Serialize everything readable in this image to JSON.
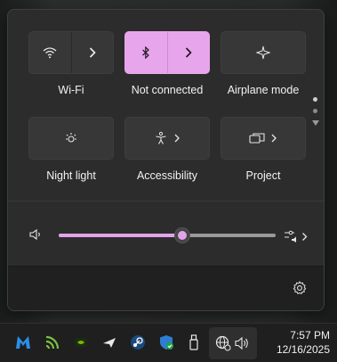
{
  "quick_settings": {
    "tiles": [
      {
        "label": "Wi-Fi",
        "icon": "wifi-icon",
        "state": "off",
        "has_expand": true
      },
      {
        "label": "Not connected",
        "icon": "bluetooth-icon",
        "state": "on",
        "has_expand": true
      },
      {
        "label": "Airplane mode",
        "icon": "airplane-icon",
        "state": "off",
        "has_expand": false
      },
      {
        "label": "Night light",
        "icon": "night-light-icon",
        "state": "off",
        "has_expand": false
      },
      {
        "label": "Accessibility",
        "icon": "accessibility-icon",
        "state": "off",
        "has_expand": true
      },
      {
        "label": "Project",
        "icon": "project-icon",
        "state": "off",
        "has_expand": true
      }
    ],
    "pages": {
      "count": 2,
      "current": 1
    },
    "volume": {
      "level_fraction": 0.57,
      "icon": "speaker-icon",
      "audio_output_icon": "audio-output-icon"
    },
    "footer": {
      "settings_icon": "settings-gear-icon"
    },
    "accent_color": "#e7a6ec"
  },
  "taskbar": {
    "icons": [
      "malwarebytes-icon",
      "nvidia-broadcast-icon",
      "nvidia-icon",
      "flight-icon",
      "steam-icon",
      "security-shield-icon",
      "usb-drive-icon",
      "network-icon",
      "volume-icon"
    ],
    "time": "7:57 PM",
    "date": "12/16/2025"
  }
}
